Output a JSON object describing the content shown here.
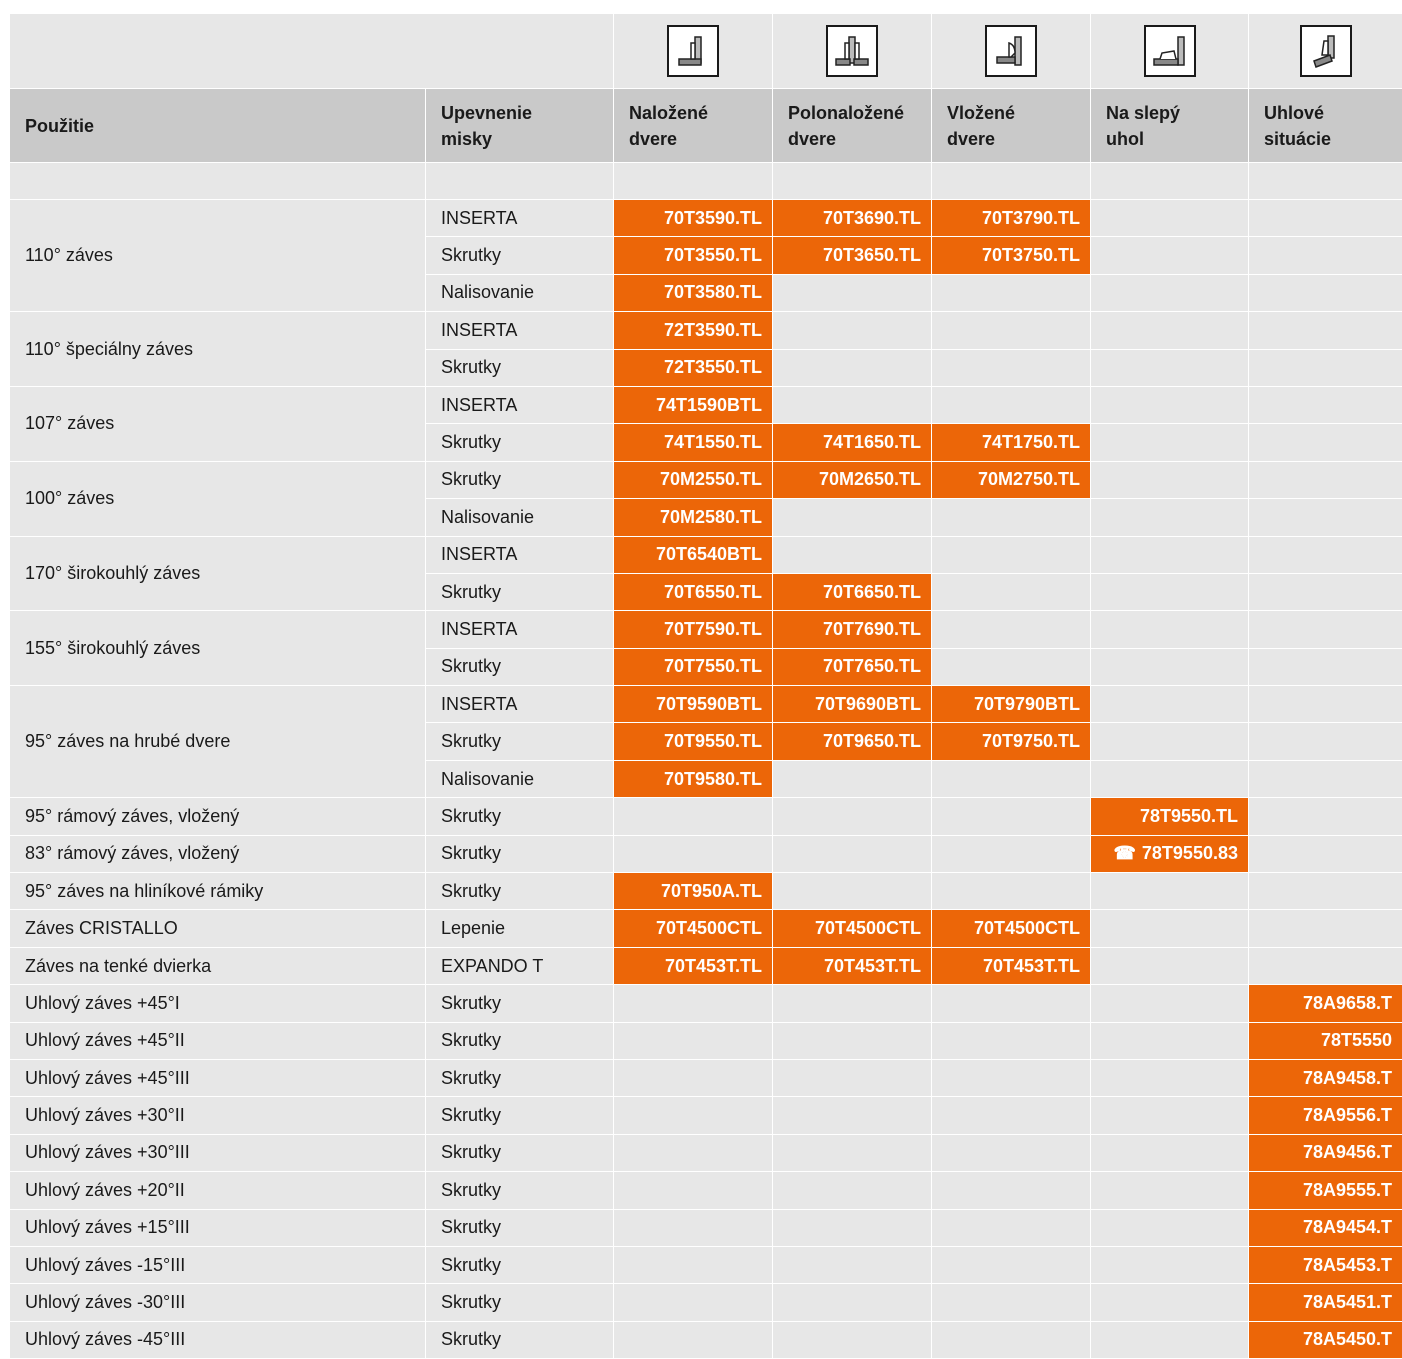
{
  "header": {
    "col_usage": "Použitie",
    "col_mount": "Upevnenie misky",
    "col_overlay": "Naložené dvere",
    "col_half": "Polonaložené dvere",
    "col_inset": "Vložené dvere",
    "col_blind": "Na slepý uhol",
    "col_angle": "Uhlové situácie"
  },
  "icons": [
    "full-overlay-hinge-icon",
    "half-overlay-hinge-icon",
    "inset-hinge-icon",
    "blind-corner-hinge-icon",
    "angled-hinge-icon"
  ],
  "accent_color": "#ec6608",
  "rows": [
    {
      "group": "110° záves",
      "span": 3,
      "mount": "INSERTA",
      "codes": [
        "70T3590.TL",
        "70T3690.TL",
        "70T3790.TL",
        "",
        ""
      ]
    },
    {
      "mount": "Skrutky",
      "codes": [
        "70T3550.TL",
        "70T3650.TL",
        "70T3750.TL",
        "",
        ""
      ]
    },
    {
      "mount": "Nalisovanie",
      "codes": [
        "70T3580.TL",
        "",
        "",
        "",
        ""
      ]
    },
    {
      "group": "110° špeciálny záves",
      "span": 2,
      "mount": "INSERTA",
      "codes": [
        "72T3590.TL",
        "",
        "",
        "",
        ""
      ]
    },
    {
      "mount": "Skrutky",
      "codes": [
        "72T3550.TL",
        "",
        "",
        "",
        ""
      ]
    },
    {
      "group": "107° záves",
      "span": 2,
      "mount": "INSERTA",
      "codes": [
        "74T1590BTL",
        "",
        "",
        "",
        ""
      ]
    },
    {
      "mount": "Skrutky",
      "codes": [
        "74T1550.TL",
        "74T1650.TL",
        "74T1750.TL",
        "",
        ""
      ]
    },
    {
      "group": "100° záves",
      "span": 2,
      "mount": "Skrutky",
      "codes": [
        "70M2550.TL",
        "70M2650.TL",
        "70M2750.TL",
        "",
        ""
      ]
    },
    {
      "mount": "Nalisovanie",
      "codes": [
        "70M2580.TL",
        "",
        "",
        "",
        ""
      ]
    },
    {
      "group": "170° širokouhlý záves",
      "span": 2,
      "mount": "INSERTA",
      "codes": [
        "70T6540BTL",
        "",
        "",
        "",
        ""
      ]
    },
    {
      "mount": "Skrutky",
      "codes": [
        "70T6550.TL",
        "70T6650.TL",
        "",
        "",
        ""
      ]
    },
    {
      "group": "155° širokouhlý záves",
      "span": 2,
      "mount": "INSERTA",
      "codes": [
        "70T7590.TL",
        "70T7690.TL",
        "",
        "",
        ""
      ]
    },
    {
      "mount": "Skrutky",
      "codes": [
        "70T7550.TL",
        "70T7650.TL",
        "",
        "",
        ""
      ]
    },
    {
      "group": "95° záves na hrubé dvere",
      "span": 3,
      "mount": "INSERTA",
      "codes": [
        "70T9590BTL",
        "70T9690BTL",
        "70T9790BTL",
        "",
        ""
      ]
    },
    {
      "mount": "Skrutky",
      "codes": [
        "70T9550.TL",
        "70T9650.TL",
        "70T9750.TL",
        "",
        ""
      ]
    },
    {
      "mount": "Nalisovanie",
      "codes": [
        "70T9580.TL",
        "",
        "",
        "",
        ""
      ]
    },
    {
      "group": "95° rámový záves, vložený",
      "span": 1,
      "mount": "Skrutky",
      "codes": [
        "",
        "",
        "",
        "78T9550.TL",
        ""
      ]
    },
    {
      "group": "83° rámový záves, vložený",
      "span": 1,
      "mount": "Skrutky",
      "codes": [
        "",
        "",
        "",
        "78T9550.83",
        ""
      ],
      "phone": 3
    },
    {
      "group": "95° záves na hliníkové rámiky",
      "span": 1,
      "mount": "Skrutky",
      "codes": [
        "70T950A.TL",
        "",
        "",
        "",
        ""
      ]
    },
    {
      "group": "Záves CRISTALLO",
      "span": 1,
      "mount": "Lepenie",
      "codes": [
        "70T4500CTL",
        "70T4500CTL",
        "70T4500CTL",
        "",
        ""
      ]
    },
    {
      "group": "Záves na tenké dvierka",
      "span": 1,
      "mount": "EXPANDO T",
      "codes": [
        "70T453T.TL",
        "70T453T.TL",
        "70T453T.TL",
        "",
        ""
      ]
    },
    {
      "group": "Uhlový záves +45°I",
      "span": 1,
      "mount": "Skrutky",
      "codes": [
        "",
        "",
        "",
        "",
        "78A9658.T"
      ]
    },
    {
      "group": "Uhlový záves +45°II",
      "span": 1,
      "mount": "Skrutky",
      "codes": [
        "",
        "",
        "",
        "",
        "78T5550"
      ]
    },
    {
      "group": "Uhlový záves +45°III",
      "span": 1,
      "mount": "Skrutky",
      "codes": [
        "",
        "",
        "",
        "",
        "78A9458.T"
      ]
    },
    {
      "group": "Uhlový záves +30°II",
      "span": 1,
      "mount": "Skrutky",
      "codes": [
        "",
        "",
        "",
        "",
        "78A9556.T"
      ]
    },
    {
      "group": "Uhlový záves +30°III",
      "span": 1,
      "mount": "Skrutky",
      "codes": [
        "",
        "",
        "",
        "",
        "78A9456.T"
      ]
    },
    {
      "group": "Uhlový záves +20°II",
      "span": 1,
      "mount": "Skrutky",
      "codes": [
        "",
        "",
        "",
        "",
        "78A9555.T"
      ]
    },
    {
      "group": "Uhlový záves +15°III",
      "span": 1,
      "mount": "Skrutky",
      "codes": [
        "",
        "",
        "",
        "",
        "78A9454.T"
      ]
    },
    {
      "group": "Uhlový záves -15°III",
      "span": 1,
      "mount": "Skrutky",
      "codes": [
        "",
        "",
        "",
        "",
        "78A5453.T"
      ]
    },
    {
      "group": "Uhlový záves -30°III",
      "span": 1,
      "mount": "Skrutky",
      "codes": [
        "",
        "",
        "",
        "",
        "78A5451.T"
      ]
    },
    {
      "group": "Uhlový záves -45°III",
      "span": 1,
      "mount": "Skrutky",
      "codes": [
        "",
        "",
        "",
        "",
        "78A5450.T"
      ]
    }
  ]
}
